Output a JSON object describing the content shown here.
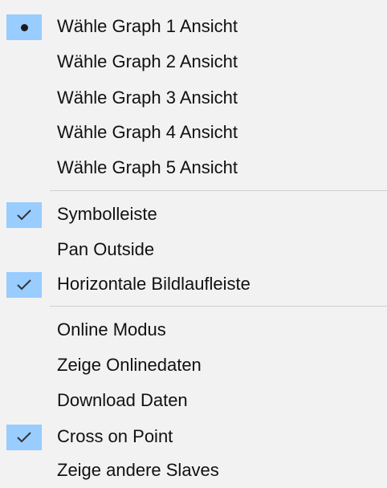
{
  "menu": {
    "group1": [
      {
        "label": "Wähle Graph 1 Ansicht"
      },
      {
        "label": "Wähle Graph 2 Ansicht"
      },
      {
        "label": "Wähle Graph 3 Ansicht"
      },
      {
        "label": "Wähle Graph 4 Ansicht"
      },
      {
        "label": "Wähle Graph 5 Ansicht"
      }
    ],
    "group2": [
      {
        "label": "Symbolleiste"
      },
      {
        "label": "Pan Outside"
      },
      {
        "label": "Horizontale Bildlaufleiste"
      }
    ],
    "group3": [
      {
        "label": "Online Modus"
      },
      {
        "label": "Zeige Onlinedaten"
      },
      {
        "label": "Download Daten"
      },
      {
        "label": "Cross on Point"
      },
      {
        "label": "Zeige andere Slaves"
      }
    ]
  },
  "state": {
    "selected_graph_view": "Wähle Graph 1 Ansicht",
    "checked_items": [
      "Symbolleiste",
      "Horizontale Bildlaufleiste",
      "Cross on Point"
    ]
  },
  "icons": {
    "radio": "radio-bullet-icon",
    "check": "checkmark-icon"
  },
  "colors": {
    "background": "#f2f2f2",
    "check_highlight": "#99ccff",
    "separator": "#cfcfcf",
    "text": "#111111"
  }
}
